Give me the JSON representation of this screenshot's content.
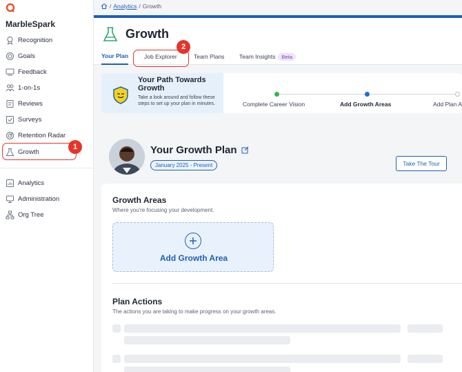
{
  "brand": {
    "name": "MarbleSpark"
  },
  "sidebar": {
    "items": [
      {
        "label": "Recognition",
        "icon": "award-icon"
      },
      {
        "label": "Goals",
        "icon": "target-icon"
      },
      {
        "label": "Feedback",
        "icon": "feedback-icon"
      },
      {
        "label": "1-on-1s",
        "icon": "people-icon"
      },
      {
        "label": "Reviews",
        "icon": "review-icon"
      },
      {
        "label": "Surveys",
        "icon": "survey-icon"
      },
      {
        "label": "Retention Radar",
        "icon": "radar-icon"
      },
      {
        "label": "Growth",
        "icon": "flask-icon"
      }
    ],
    "secondary": [
      {
        "label": "Analytics",
        "icon": "chart-icon"
      },
      {
        "label": "Administration",
        "icon": "admin-icon"
      },
      {
        "label": "Org Tree",
        "icon": "org-tree-icon"
      }
    ]
  },
  "annotations": {
    "one": "1",
    "two": "2"
  },
  "breadcrumb": {
    "home_icon": "home-icon",
    "link": "Analytics",
    "sep": "/",
    "current": "Growth"
  },
  "header": {
    "title": "Growth",
    "tabs": [
      {
        "label": "Your Plan"
      },
      {
        "label": "Job Explorer"
      },
      {
        "label": "Team Plans"
      },
      {
        "label": "Team Insights"
      }
    ],
    "beta": "Beta"
  },
  "path": {
    "title": "Your Path Towards Growth",
    "description": "Take a look around and follow these steps to set up your plan in minutes.",
    "steps": [
      {
        "label": "Complete Career Vision",
        "status": "done"
      },
      {
        "label": "Add Growth Areas",
        "status": "current"
      },
      {
        "label": "Add Plan A",
        "status": "todo"
      }
    ]
  },
  "plan": {
    "title": "Your Growth Plan",
    "date_range": "January 2025 - Present",
    "tour_button": "Take The Tour"
  },
  "growth_areas": {
    "title": "Growth Areas",
    "subtitle": "Where you're focusing your development.",
    "add_label": "Add Growth Area"
  },
  "plan_actions": {
    "title": "Plan Actions",
    "subtitle": "The actions you are taking to make progress on your growth areas."
  },
  "colors": {
    "accent": "#1d5fb8",
    "annotation": "#e5352a",
    "done": "#2fb85a"
  }
}
